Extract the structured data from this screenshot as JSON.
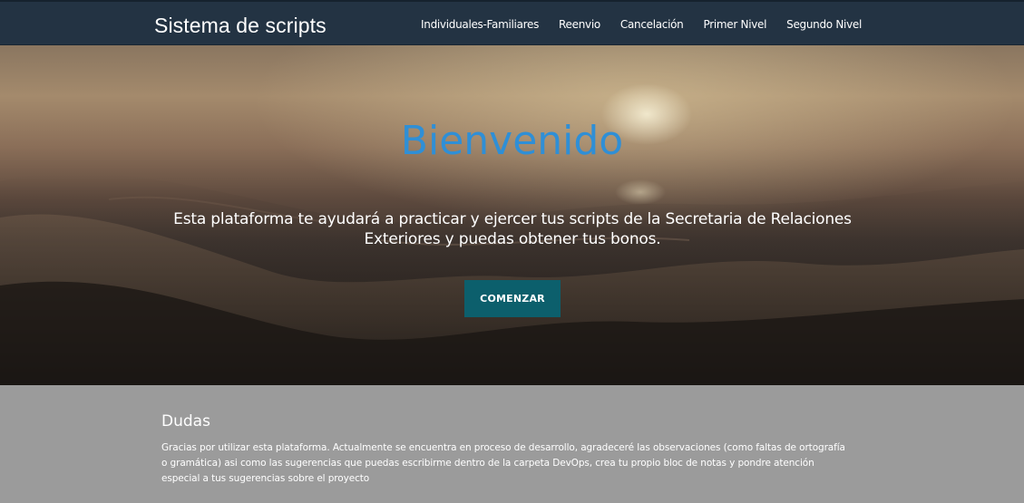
{
  "navbar": {
    "brand": "Sistema de scripts",
    "links": [
      {
        "label": "Individuales-Familiares"
      },
      {
        "label": "Reenvio"
      },
      {
        "label": "Cancelación"
      },
      {
        "label": "Primer Nivel"
      },
      {
        "label": "Segundo Nivel"
      }
    ],
    "background_color": "#233343"
  },
  "hero": {
    "title": "Bienvenido",
    "text": "Esta plataforma te ayudará a practicar y ejercer tus scripts de la Secretaria de Relaciones Exteriores y puedas obtener tus bonos.",
    "button_label": "COMENZAR",
    "title_color": "#2f8fd6",
    "button_color": "#0c5f6c"
  },
  "dudas": {
    "title": "Dudas",
    "text": "Gracias por utilizar esta plataforma. Actualmente se encuentra en proceso de desarrollo, agradeceré las observaciones (como faltas de ortografía o gramática) asi como las sugerencias que puedas escribirme dentro de la carpeta DevOps, crea tu propio bloc de notas y pondre atención especial a tus sugerencias sobre el proyecto",
    "background_color": "#9b9b9b"
  }
}
